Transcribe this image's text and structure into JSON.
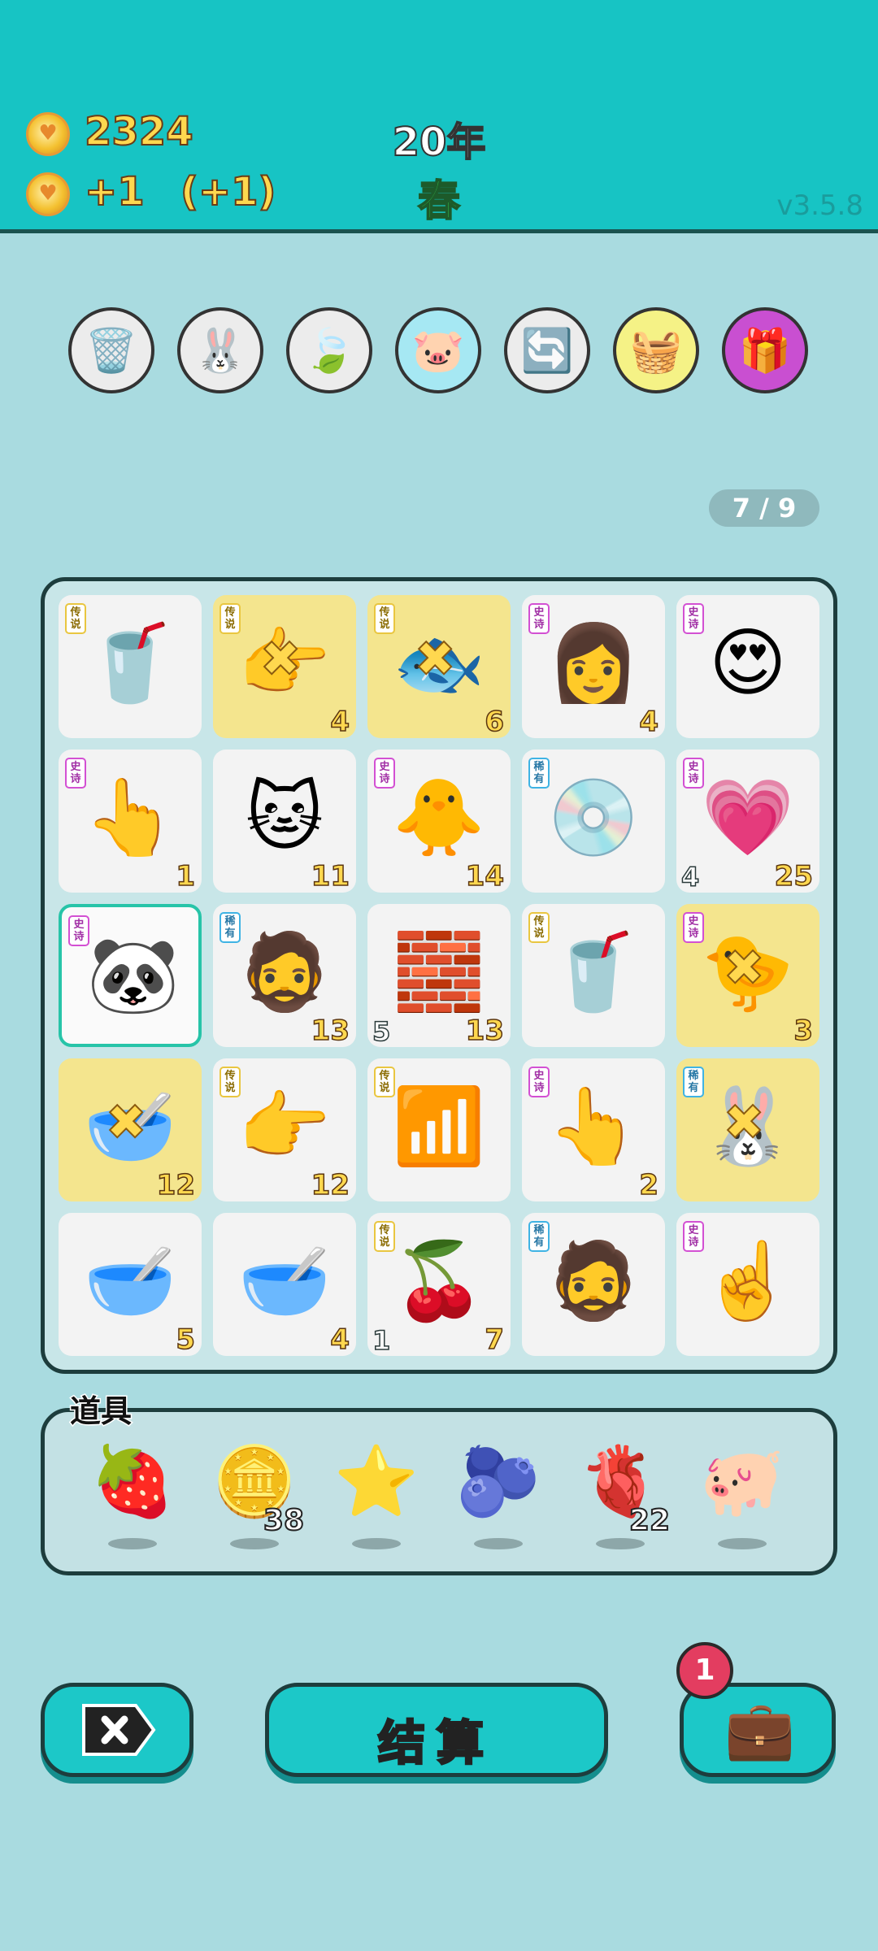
{
  "header": {
    "coins": "2324",
    "income": "+1",
    "income_bonus": "(+1)",
    "year": "20年",
    "season": "春",
    "version": "v3.5.8"
  },
  "toolbar": [
    {
      "name": "trash-recycle-tool",
      "icon": "🗑️",
      "bg": "#ececec"
    },
    {
      "name": "rabbit-tool",
      "icon": "🐰",
      "bg": "#ececec",
      "badge": true
    },
    {
      "name": "leaf-tool",
      "icon": "🍃",
      "bg": "#ececec",
      "badge": true
    },
    {
      "name": "piggy-bank-tool",
      "icon": "🐷",
      "bg": "#a6e8f3"
    },
    {
      "name": "refresh-tool",
      "icon": "🔄",
      "bg": "#ececec",
      "badge": true
    },
    {
      "name": "fruit-basket-tool",
      "icon": "🧺",
      "bg": "#f5f286"
    },
    {
      "name": "gift-tool",
      "icon": "🎁",
      "bg": "#c94fd1"
    }
  ],
  "pager": "7 / 9",
  "board": [
    {
      "icon": "🥤",
      "tag": "传说",
      "tag_type": "le"
    },
    {
      "icon": "👉",
      "tag": "传说",
      "tag_type": "le",
      "count": "4",
      "yellow": true,
      "marked": true
    },
    {
      "icon": "🐟",
      "tag": "传说",
      "tag_type": "le",
      "count": "6",
      "yellow": true,
      "marked": true
    },
    {
      "icon": "👩",
      "tag": "史诗",
      "tag_type": "ep",
      "count": "4"
    },
    {
      "icon": "😍",
      "tag": "史诗",
      "tag_type": "ep"
    },
    {
      "icon": "👆",
      "tag": "史诗",
      "tag_type": "ep",
      "count": "1"
    },
    {
      "icon": "🐱",
      "count": "11"
    },
    {
      "icon": "🐥",
      "tag": "史诗",
      "tag_type": "ep",
      "count": "14"
    },
    {
      "icon": "💿",
      "tag": "稀有",
      "tag_type": "ra"
    },
    {
      "icon": "💗",
      "tag": "史诗",
      "tag_type": "ep",
      "count": "25",
      "left_count": "4"
    },
    {
      "icon": "🐼",
      "tag": "史诗",
      "tag_type": "ep",
      "selected": true
    },
    {
      "icon": "🧔",
      "tag": "稀有",
      "tag_type": "ra",
      "count": "13"
    },
    {
      "icon": "🧱",
      "count": "13",
      "left_count": "5"
    },
    {
      "icon": "🥤",
      "tag": "传说",
      "tag_type": "le"
    },
    {
      "icon": "🐤",
      "tag": "史诗",
      "tag_type": "ep",
      "count": "3",
      "yellow": true,
      "marked": true
    },
    {
      "icon": "🥣",
      "count": "12",
      "yellow": true,
      "marked": true
    },
    {
      "icon": "👉",
      "tag": "传说",
      "tag_type": "le",
      "count": "12"
    },
    {
      "icon": "📶",
      "tag": "传说",
      "tag_type": "le"
    },
    {
      "icon": "👆",
      "tag": "史诗",
      "tag_type": "ep",
      "count": "2"
    },
    {
      "icon": "🐰",
      "tag": "稀有",
      "tag_type": "ra",
      "yellow": true,
      "marked": true
    },
    {
      "icon": "🥣",
      "count": "5"
    },
    {
      "icon": "🥣",
      "count": "4"
    },
    {
      "icon": "🍒",
      "tag": "传说",
      "tag_type": "le",
      "count": "7",
      "left_count": "1"
    },
    {
      "icon": "🧔",
      "tag": "稀有",
      "tag_type": "ra"
    },
    {
      "icon": "☝️",
      "tag": "史诗",
      "tag_type": "ep"
    }
  ],
  "items_title": "道具",
  "items": [
    {
      "name": "lychee-item",
      "icon": "🍓"
    },
    {
      "name": "coin-item",
      "icon": "🪙",
      "count": "38"
    },
    {
      "name": "star-item",
      "icon": "⭐"
    },
    {
      "name": "blueberry-item",
      "icon": "🫐"
    },
    {
      "name": "liver-item",
      "icon": "🫀",
      "count": "22"
    },
    {
      "name": "piggy-item",
      "icon": "🐖"
    }
  ],
  "buttons": {
    "settle_label": "结算",
    "notification_count": "1"
  }
}
